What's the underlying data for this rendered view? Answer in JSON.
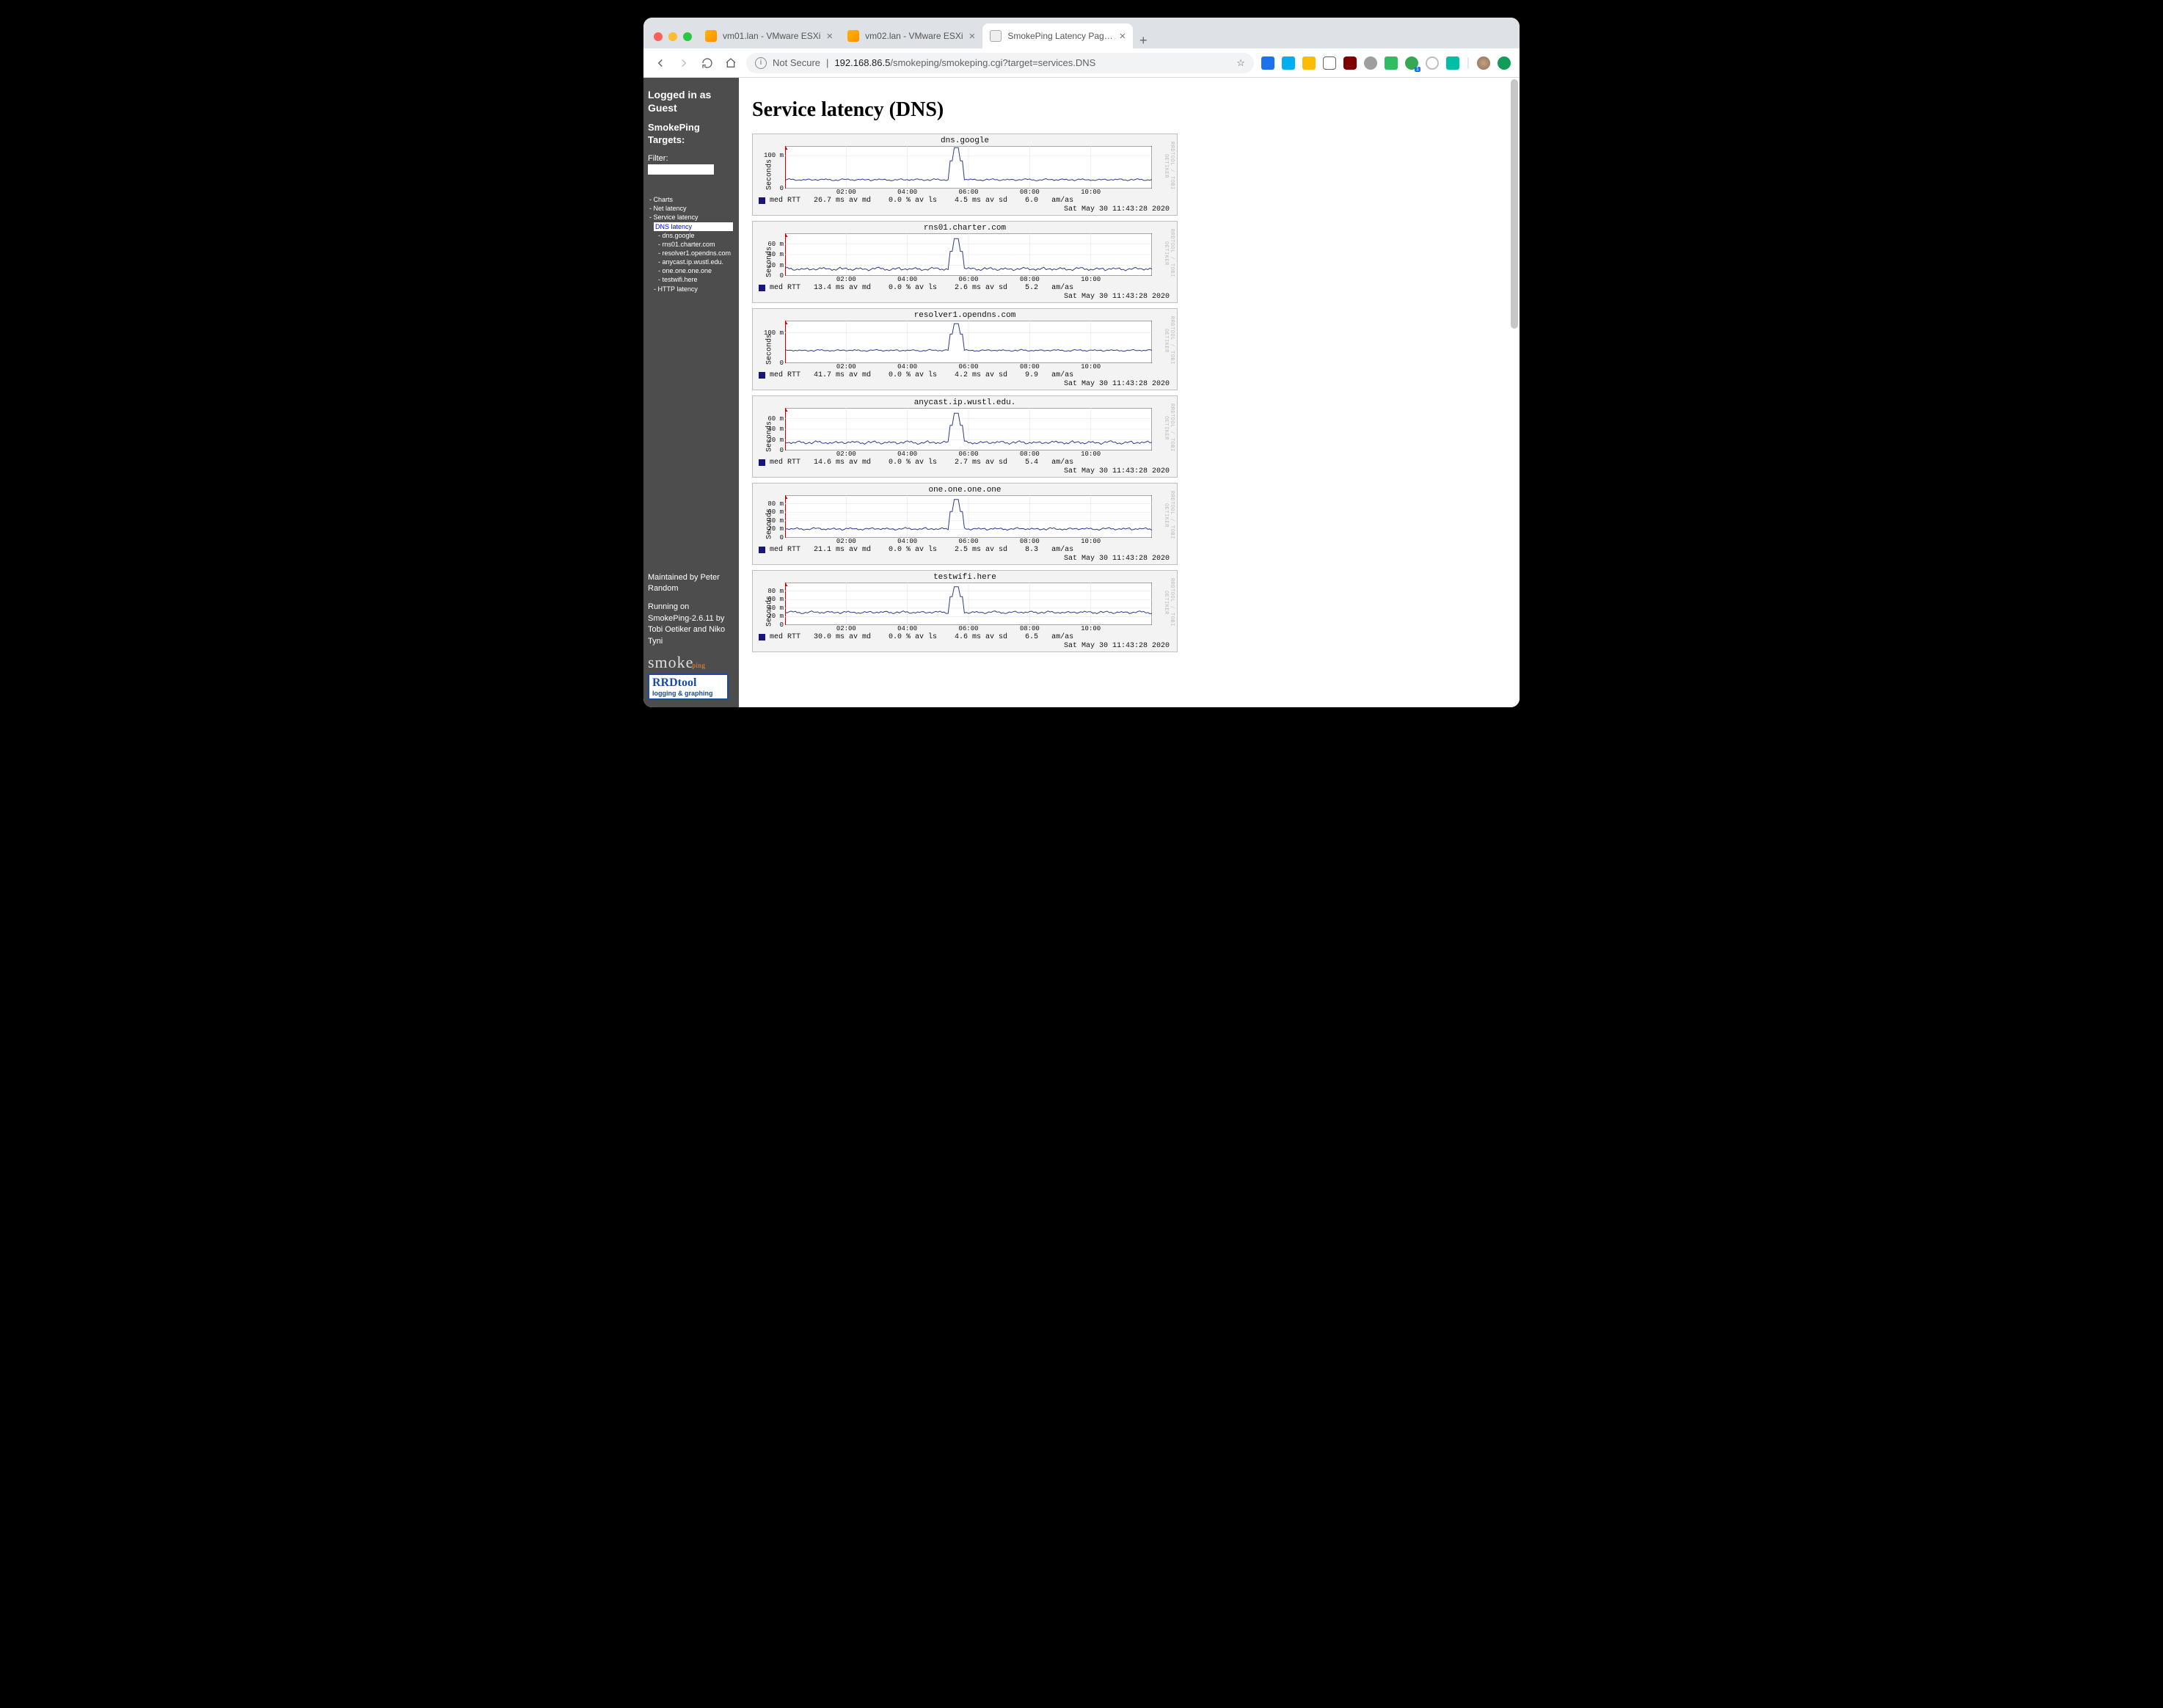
{
  "browser": {
    "tabs": [
      {
        "title": "vm01.lan - VMware ESXi",
        "active": false,
        "fav": "vm"
      },
      {
        "title": "vm02.lan - VMware ESXi",
        "active": false,
        "fav": "vm"
      },
      {
        "title": "SmokePing Latency Page for S",
        "active": true,
        "fav": "globe"
      }
    ],
    "security_label": "Not Secure",
    "url_host": "192.168.86.5",
    "url_path": "/smokeping/smokeping.cgi?target=services.DNS"
  },
  "sidebar": {
    "login_line1": "Logged in as",
    "login_line2": "Guest",
    "targets_line1": "SmokePing",
    "targets_line2": "Targets:",
    "filter_label": "Filter:",
    "tree": [
      {
        "label": "- Charts",
        "level": 0
      },
      {
        "label": "- Net latency",
        "level": 0
      },
      {
        "label": "- Service latency",
        "level": 0
      },
      {
        "label": "DNS latency",
        "level": 1,
        "selected": true
      },
      {
        "label": "- dns.google",
        "level": 2
      },
      {
        "label": "- rns01.charter.com",
        "level": 2
      },
      {
        "label": "- resolver1.opendns.com",
        "level": 2
      },
      {
        "label": "- anycast.ip.wustl.edu.",
        "level": 2
      },
      {
        "label": "- one.one.one.one",
        "level": 2
      },
      {
        "label": "- testwifi.here",
        "level": 2
      },
      {
        "label": "- HTTP latency",
        "level": 1
      }
    ],
    "maintained_by": "Maintained by Peter Random",
    "running_on": "Running on SmokePing-2.6.11 by Tobi Oetiker and Niko Tyni",
    "logo_smoke": "smoke",
    "logo_ping": "ping",
    "rrd_line1": "RRDtool",
    "rrd_line2": "logging & graphing"
  },
  "page": {
    "title": "Service latency (DNS)"
  },
  "chart_common": {
    "ylabel": "Seconds",
    "x_ticks": [
      "02:00",
      "04:00",
      "06:00",
      "08:00",
      "10:00"
    ],
    "x_range_hours": [
      0,
      12
    ],
    "x_tick_hours": [
      2,
      4,
      6,
      8,
      10
    ],
    "timestamp": "Sat May 30 11:43:28 2020",
    "watermark": "RRDTOOL / TOBI OETIKER",
    "legend_med": "med RTT",
    "avls": "0.0 % av ls",
    "spike_hour": 5.6,
    "series_color": "#2f3b8f",
    "legend_swatch_color": "#16167d"
  },
  "chart_data": [
    {
      "type": "line",
      "title": "dns.google",
      "y_ticks": [
        {
          "v": 0,
          "label": "0"
        },
        {
          "v": 100,
          "label": "100 m"
        }
      ],
      "ylim": [
        0,
        130
      ],
      "baseline_ms": 27,
      "spike_ms": 125,
      "stats": {
        "avmd_ms": 26.7,
        "avsd_ms": 4.5,
        "amas": 6.0
      },
      "legend": "med RTT   26.7 ms av md    0.0 % av ls    4.5 ms av sd    6.0   am/as"
    },
    {
      "type": "line",
      "title": "rns01.charter.com",
      "y_ticks": [
        {
          "v": 0,
          "label": "0"
        },
        {
          "v": 20,
          "label": "20 m"
        },
        {
          "v": 40,
          "label": "40 m"
        },
        {
          "v": 60,
          "label": "60 m"
        }
      ],
      "ylim": [
        0,
        80
      ],
      "baseline_ms": 13,
      "spike_ms": 70,
      "stats": {
        "avmd_ms": 13.4,
        "avsd_ms": 2.6,
        "amas": 5.2
      },
      "legend": "med RTT   13.4 ms av md    0.0 % av ls    2.6 ms av sd    5.2   am/as"
    },
    {
      "type": "line",
      "title": "resolver1.opendns.com",
      "y_ticks": [
        {
          "v": 0,
          "label": "0"
        },
        {
          "v": 100,
          "label": "100 m"
        }
      ],
      "ylim": [
        0,
        140
      ],
      "baseline_ms": 42,
      "spike_ms": 130,
      "stats": {
        "avmd_ms": 41.7,
        "avsd_ms": 4.2,
        "amas": 9.9
      },
      "legend": "med RTT   41.7 ms av md    0.0 % av ls    4.2 ms av sd    9.9   am/as"
    },
    {
      "type": "line",
      "title": "anycast.ip.wustl.edu.",
      "y_ticks": [
        {
          "v": 0,
          "label": "0"
        },
        {
          "v": 20,
          "label": "20 m"
        },
        {
          "v": 40,
          "label": "40 m"
        },
        {
          "v": 60,
          "label": "60 m"
        }
      ],
      "ylim": [
        0,
        80
      ],
      "baseline_ms": 15,
      "spike_ms": 70,
      "stats": {
        "avmd_ms": 14.6,
        "avsd_ms": 2.7,
        "amas": 5.4
      },
      "legend": "med RTT   14.6 ms av md    0.0 % av ls    2.7 ms av sd    5.4   am/as"
    },
    {
      "type": "line",
      "title": "one.one.one.one",
      "y_ticks": [
        {
          "v": 0,
          "label": "0"
        },
        {
          "v": 20,
          "label": "20 m"
        },
        {
          "v": 40,
          "label": "40 m"
        },
        {
          "v": 60,
          "label": "60 m"
        },
        {
          "v": 80,
          "label": "80 m"
        }
      ],
      "ylim": [
        0,
        100
      ],
      "baseline_ms": 21,
      "spike_ms": 90,
      "stats": {
        "avmd_ms": 21.1,
        "avsd_ms": 2.5,
        "amas": 8.3
      },
      "legend": "med RTT   21.1 ms av md    0.0 % av ls    2.5 ms av sd    8.3   am/as"
    },
    {
      "type": "line",
      "title": "testwifi.here",
      "y_ticks": [
        {
          "v": 0,
          "label": "0"
        },
        {
          "v": 20,
          "label": "20 m"
        },
        {
          "v": 40,
          "label": "40 m"
        },
        {
          "v": 60,
          "label": "60 m"
        },
        {
          "v": 80,
          "label": "80 m"
        }
      ],
      "ylim": [
        0,
        100
      ],
      "baseline_ms": 30,
      "spike_ms": 90,
      "stats": {
        "avmd_ms": 30.0,
        "avsd_ms": 4.6,
        "amas": 6.5
      },
      "legend": "med RTT   30.0 ms av md    0.0 % av ls    4.6 ms av sd    6.5   am/as"
    }
  ]
}
